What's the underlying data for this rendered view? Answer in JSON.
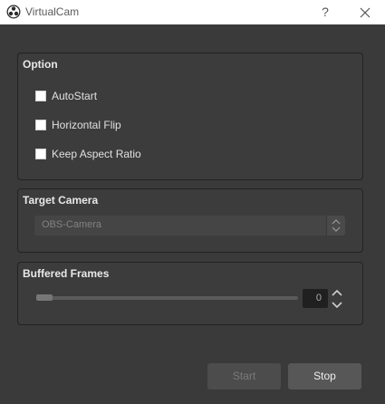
{
  "window": {
    "title": "VirtualCam",
    "icon": "obs-logo-icon",
    "help_label": "?",
    "close_icon": "close-icon"
  },
  "option_group": {
    "title": "Option",
    "checkboxes": [
      {
        "label": "AutoStart",
        "checked": false
      },
      {
        "label": "Horizontal Flip",
        "checked": false
      },
      {
        "label": "Keep Aspect Ratio",
        "checked": false
      }
    ]
  },
  "target_camera": {
    "title": "Target Camera",
    "selected": "OBS-Camera",
    "disabled": true
  },
  "buffered_frames": {
    "title": "Buffered Frames",
    "value": "0",
    "slider_value": 0
  },
  "buttons": {
    "start": "Start",
    "start_disabled": true,
    "stop": "Stop"
  },
  "colors": {
    "background": "#3a3a3a",
    "titlebar": "#ffffff"
  }
}
